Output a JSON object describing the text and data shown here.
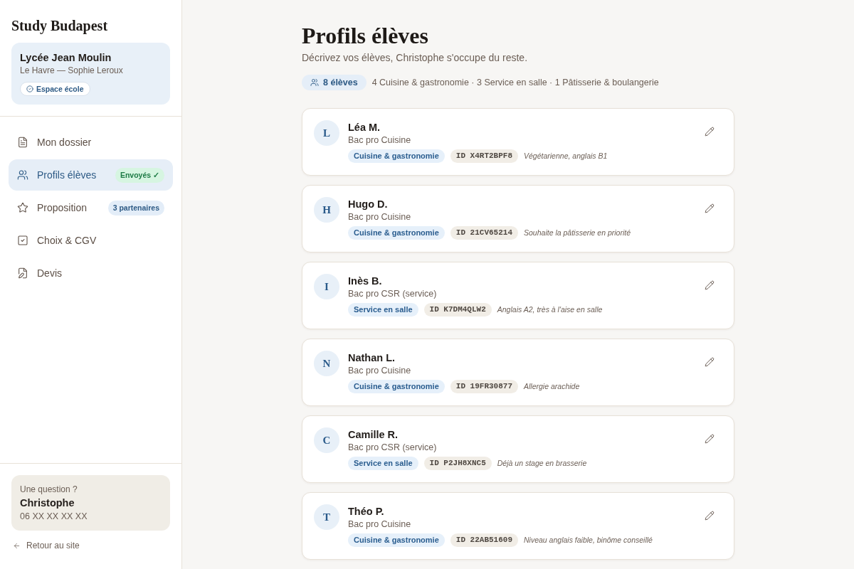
{
  "sidebar": {
    "brand": "Study Budapest",
    "school": {
      "name": "Lycée Jean Moulin",
      "details": "Le Havre — Sophie Leroux",
      "badge": "Espace école"
    },
    "nav": [
      {
        "label": "Mon dossier",
        "selected": false
      },
      {
        "label": "Profils élèves",
        "selected": true,
        "badge": {
          "text": "Envoyés ✓",
          "kind": "success"
        }
      },
      {
        "label": "Proposition",
        "selected": false,
        "badge": {
          "text": "3 partenaires",
          "kind": "info"
        }
      },
      {
        "label": "Choix & CGV",
        "selected": false
      },
      {
        "label": "Devis",
        "selected": false
      }
    ],
    "contact": {
      "prompt": "Une question ?",
      "name": "Christophe",
      "phone": "06 XX XX XX XX"
    },
    "back_link": "Retour au site"
  },
  "main": {
    "title": "Profils élèves",
    "subtitle": "Décrivez vos élèves, Christophe s'occupe du reste.",
    "summary": {
      "count": "8 élèves",
      "breakdown": "4 Cuisine & gastronomie · 3 Service en salle · 1 Pâtisserie & boulangerie"
    },
    "students": [
      {
        "initial": "L",
        "name": "Léa M.",
        "program": "Bac pro Cuisine",
        "track": "Cuisine & gastronomie",
        "id": "ID X4RT2BPF8",
        "note": "Végétarienne, anglais B1"
      },
      {
        "initial": "H",
        "name": "Hugo D.",
        "program": "Bac pro Cuisine",
        "track": "Cuisine & gastronomie",
        "id": "ID 21CV65214",
        "note": "Souhaite la pâtisserie en priorité"
      },
      {
        "initial": "I",
        "name": "Inès B.",
        "program": "Bac pro CSR (service)",
        "track": "Service en salle",
        "id": "ID K7DM4QLW2",
        "note": "Anglais A2, très à l'aise en salle"
      },
      {
        "initial": "N",
        "name": "Nathan L.",
        "program": "Bac pro Cuisine",
        "track": "Cuisine & gastronomie",
        "id": "ID 19FR30877",
        "note": "Allergie arachide"
      },
      {
        "initial": "C",
        "name": "Camille R.",
        "program": "Bac pro CSR (service)",
        "track": "Service en salle",
        "id": "ID P2JH8XNC5",
        "note": "Déjà un stage en brasserie"
      },
      {
        "initial": "T",
        "name": "Théo P.",
        "program": "Bac pro Cuisine",
        "track": "Cuisine & gastronomie",
        "id": "ID 22AB51609",
        "note": "Niveau anglais faible, binôme conseillé"
      }
    ]
  }
}
